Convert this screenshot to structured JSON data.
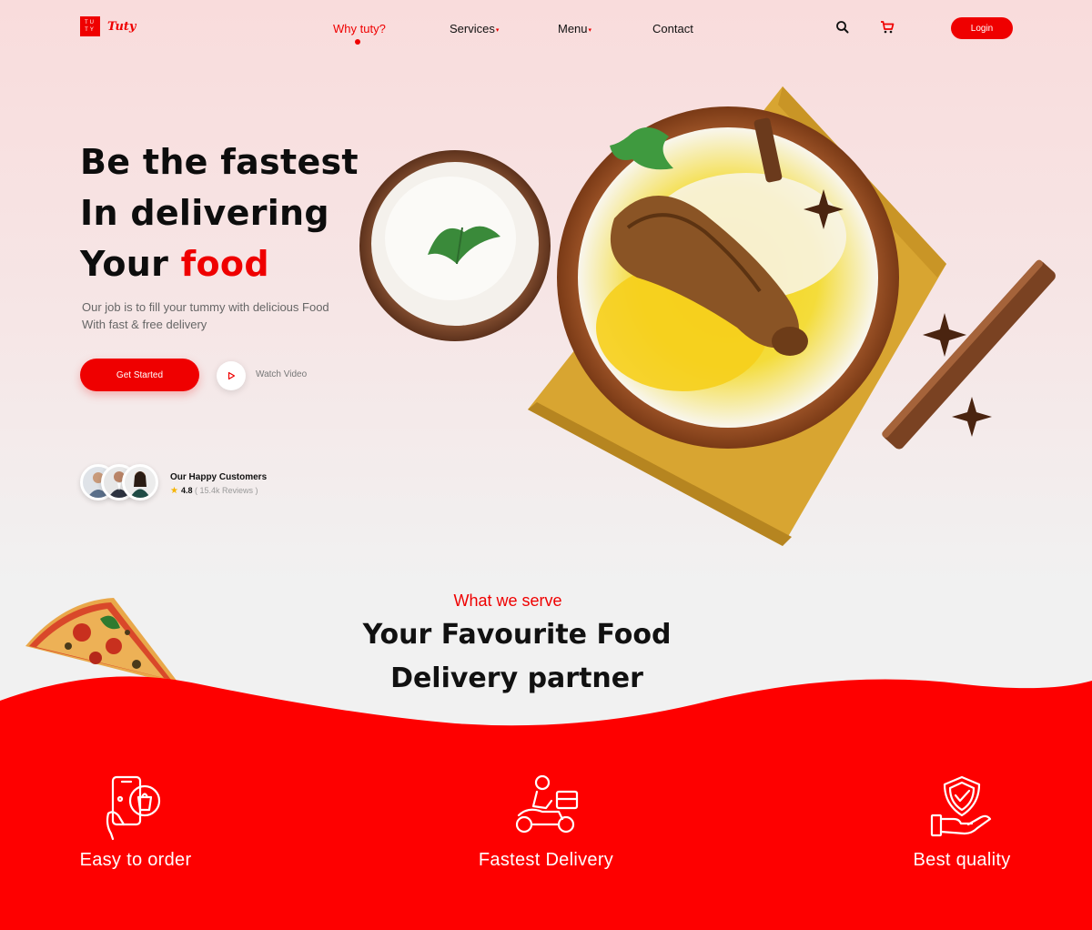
{
  "brand": {
    "logo_text": "Tuty",
    "logo_letters": "TU TY"
  },
  "nav": {
    "items": [
      {
        "label": "Why tuty?",
        "has_caret": false,
        "active": true
      },
      {
        "label": "Services",
        "has_caret": true,
        "active": false
      },
      {
        "label": "Menu",
        "has_caret": true,
        "active": false
      },
      {
        "label": "Contact",
        "has_caret": false,
        "active": false
      }
    ],
    "caret": "▾",
    "search_icon": "search-icon",
    "cart_icon": "cart-icon",
    "login_label": "Login"
  },
  "hero": {
    "headline_line1": "Be the fastest",
    "headline_line2": "In delivering",
    "headline_line3_prefix": "Your ",
    "headline_line3_accent": "food",
    "subtext_line1": "Our job is to fill your tummy with delicious Food",
    "subtext_line2": "With fast & free delivery",
    "cta_label": "Get Started",
    "video_label": "Watch Video"
  },
  "customers": {
    "title": "Our Happy Customers",
    "rating": "4.8",
    "reviews": "( 15.4k Reviews )"
  },
  "section": {
    "eyebrow": "What we serve",
    "title_line1": "Your Favourite Food",
    "title_line2": "Delivery partner"
  },
  "features": [
    {
      "label": "Easy to order",
      "icon": "phone-shopping-icon"
    },
    {
      "label": "Fastest Delivery",
      "icon": "delivery-scooter-icon"
    },
    {
      "label": "Best quality",
      "icon": "quality-shield-icon"
    }
  ],
  "colors": {
    "accent": "#ef0000",
    "hero_bg": "#f9dcdc",
    "page_bg": "#f1f1f1",
    "star": "#f5b400"
  }
}
